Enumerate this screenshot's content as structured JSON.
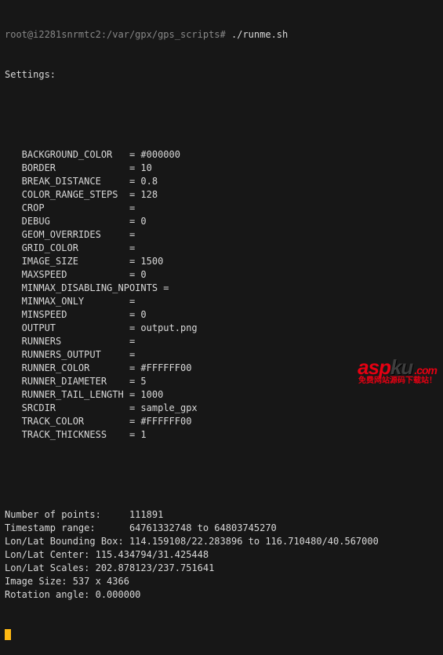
{
  "prompt": {
    "cwd": "root@i2281snrmtc2:/var/gpx/gps_scripts#",
    "cmd": "./runme.sh"
  },
  "hdr": "Settings:",
  "settings": [
    {
      "k": "BACKGROUND_COLOR",
      "v": "#000000"
    },
    {
      "k": "BORDER",
      "v": "10"
    },
    {
      "k": "BREAK_DISTANCE",
      "v": "0.8"
    },
    {
      "k": "COLOR_RANGE_STEPS",
      "v": "128"
    },
    {
      "k": "CROP",
      "v": ""
    },
    {
      "k": "DEBUG",
      "v": "0"
    },
    {
      "k": "GEOM_OVERRIDES",
      "v": ""
    },
    {
      "k": "GRID_COLOR",
      "v": ""
    },
    {
      "k": "IMAGE_SIZE",
      "v": "1500"
    },
    {
      "k": "MAXSPEED",
      "v": "0"
    },
    {
      "k": "MINMAX_DISABLING_NPOINTS",
      "v": ""
    },
    {
      "k": "MINMAX_ONLY",
      "v": ""
    },
    {
      "k": "MINSPEED",
      "v": "0"
    },
    {
      "k": "OUTPUT",
      "v": "output.png"
    },
    {
      "k": "RUNNERS",
      "v": ""
    },
    {
      "k": "RUNNERS_OUTPUT",
      "v": ""
    },
    {
      "k": "RUNNER_COLOR",
      "v": "#FFFFFF00"
    },
    {
      "k": "RUNNER_DIAMETER",
      "v": "5"
    },
    {
      "k": "RUNNER_TAIL_LENGTH",
      "v": "1000"
    },
    {
      "k": "SRCDIR",
      "v": "sample_gpx"
    },
    {
      "k": "TRACK_COLOR",
      "v": "#FFFFFF00"
    },
    {
      "k": "TRACK_THICKNESS",
      "v": "1"
    }
  ],
  "info": [
    {
      "k": "Number of points:",
      "v": "111891"
    },
    {
      "k": "Timestamp range:",
      "v": "64761332748 to 64803745270"
    },
    {
      "k": "Lon/Lat Bounding Box:",
      "v": "114.159108/22.283896 to 116.710480/40.567000"
    },
    {
      "k": "Lon/Lat Center:",
      "v": "115.434794/31.425448"
    },
    {
      "k": "Lon/Lat Scales:",
      "v": "202.878123/237.751641"
    },
    {
      "k": "Image Size:",
      "v": "537 x 4366"
    },
    {
      "k": "Rotation angle:",
      "v": "0.000000"
    }
  ],
  "watermark": {
    "a": "asp",
    "b": "ku",
    "dot": ".com",
    "sub": "免费网站源码下载站！"
  },
  "layout": {
    "keycol": 25,
    "indent": 3,
    "infokey": 22
  }
}
